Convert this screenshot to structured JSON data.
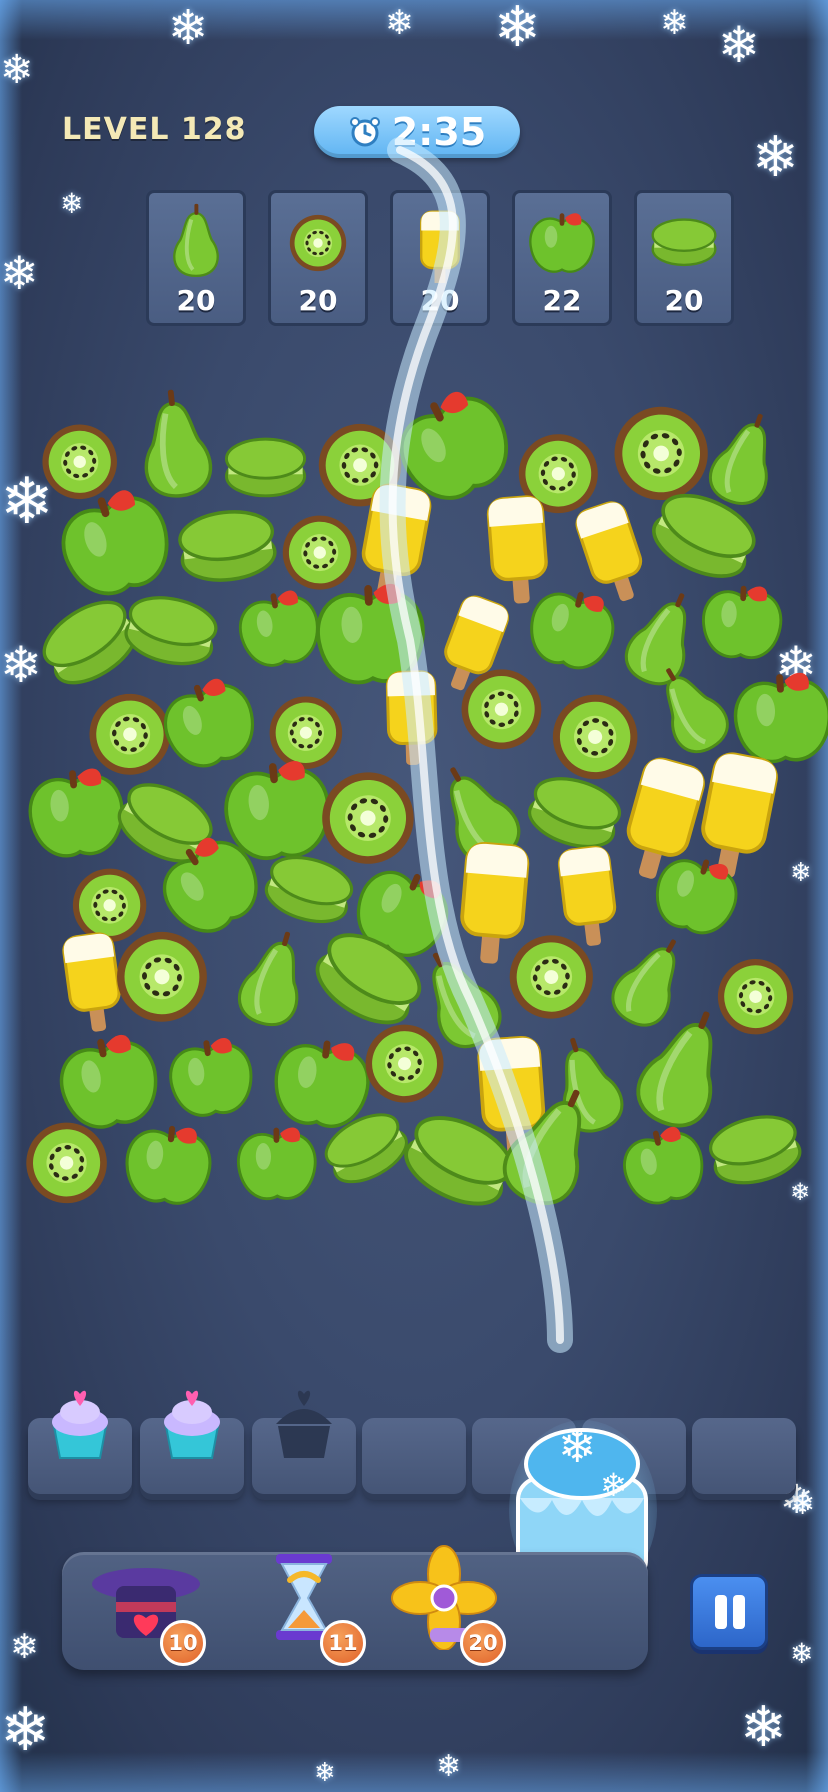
{
  "level": {
    "label": "LEVEL 128"
  },
  "timer": {
    "value": "2:35",
    "icon": "alarm-clock-icon"
  },
  "goals": [
    {
      "item": "pear",
      "count": "20"
    },
    {
      "item": "kiwi",
      "count": "20"
    },
    {
      "item": "popsicle",
      "count": "20"
    },
    {
      "item": "apple",
      "count": "22"
    },
    {
      "item": "macaron",
      "count": "20"
    }
  ],
  "tray": {
    "slots_total": 7,
    "items": [
      "cupcake",
      "cupcake",
      "cupcake-silhouette"
    ]
  },
  "freeze_effect": {
    "icon": "frozen-cake-snowflake-icon"
  },
  "boosters": [
    {
      "name": "magic-hat",
      "count": "10"
    },
    {
      "name": "hourglass-undo",
      "count": "11"
    },
    {
      "name": "fan",
      "count": "20"
    }
  ],
  "pause": {
    "icon": "pause-icon"
  },
  "colors": {
    "background": "#3a4a6c",
    "level_text": "#f4e9b6",
    "timer_pill": "#7cc5f6",
    "goal_card": "#51668c",
    "badge": "#ea7a3c",
    "pause_button": "#3b7de0"
  }
}
